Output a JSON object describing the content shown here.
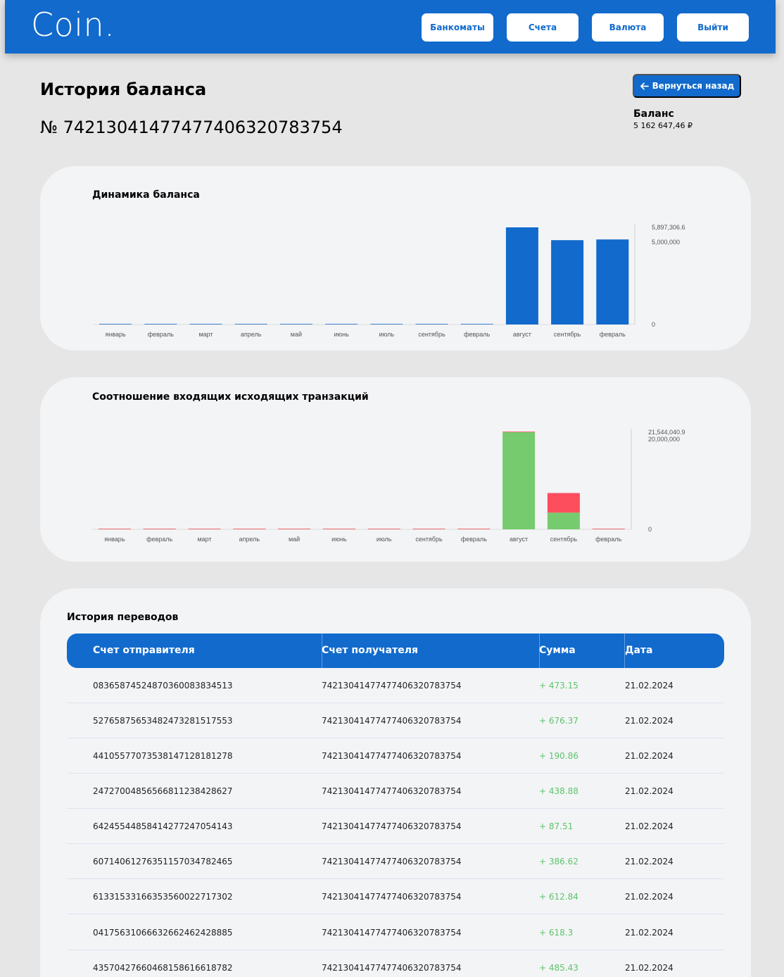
{
  "header": {
    "logo": "Coin.",
    "nav": [
      "Банкоматы",
      "Счета",
      "Валюта",
      "Выйти"
    ]
  },
  "page": {
    "title": "История баланса",
    "account_number": "№ 74213041477477406320783754",
    "back_label": "Вернуться назад",
    "balance_label": "Баланс",
    "balance_value": "5 162 647,46 ₽"
  },
  "colors": {
    "accent": "#116acc",
    "income": "#76cb6e",
    "outcome": "#fd4e5d",
    "card": "#f3f4f6"
  },
  "chart_data": [
    {
      "type": "bar",
      "title": "Динамика баланса",
      "categories": [
        "январь",
        "февраль",
        "март",
        "апрель",
        "май",
        "июнь",
        "июль",
        "сентябрь",
        "февраль",
        "август",
        "сентябрь",
        "февраль"
      ],
      "values": [
        0,
        0,
        0,
        0,
        0,
        0,
        0,
        0,
        20000,
        5897306.6,
        5120000,
        5162647.46
      ],
      "y_ticks": [
        "5,897,306.6",
        "5,000,000",
        "0"
      ],
      "y_tick_values": [
        5897306.6,
        5000000,
        0
      ],
      "ylim": [
        0,
        5897306.6
      ]
    },
    {
      "type": "bar",
      "stacked": true,
      "title": "Соотношение входящих исходящих транзакций",
      "categories": [
        "январь",
        "февраль",
        "март",
        "апрель",
        "май",
        "июнь",
        "июль",
        "сентябрь",
        "февраль",
        "август",
        "сентябрь",
        "февраль"
      ],
      "series": [
        {
          "values": [
            0,
            0,
            0,
            0,
            0,
            0,
            0,
            0,
            0,
            21544040.9,
            3700000,
            0
          ],
          "color": "#76cb6e"
        },
        {
          "values": [
            0,
            0,
            0,
            0,
            0,
            0,
            0,
            0,
            0,
            0,
            4350000,
            0
          ],
          "color": "#fd4e5d"
        }
      ],
      "y_ticks": [
        "21,544,040.9",
        "20,000,000",
        "0"
      ],
      "y_tick_values": [
        21544040.9,
        20000000,
        0
      ],
      "ylim": [
        0,
        21544040.9
      ]
    }
  ],
  "transfers": {
    "title": "История переводов",
    "columns": [
      "Счет отправителя",
      "Счет получателя",
      "Сумма",
      "Дата"
    ],
    "rows": [
      {
        "from": "08365874524870360083834513",
        "to": "74213041477477406320783754",
        "amount": "+ 473.15",
        "date": "21.02.2024"
      },
      {
        "from": "52765875653482473281517553",
        "to": "74213041477477406320783754",
        "amount": "+ 676.37",
        "date": "21.02.2024"
      },
      {
        "from": "44105577073538147128181278",
        "to": "74213041477477406320783754",
        "amount": "+ 190.86",
        "date": "21.02.2024"
      },
      {
        "from": "24727004856566811238428627",
        "to": "74213041477477406320783754",
        "amount": "+ 438.88",
        "date": "21.02.2024"
      },
      {
        "from": "64245544858414277247054143",
        "to": "74213041477477406320783754",
        "amount": "+ 87.51",
        "date": "21.02.2024"
      },
      {
        "from": "60714061276351157034782465",
        "to": "74213041477477406320783754",
        "amount": "+ 386.62",
        "date": "21.02.2024"
      },
      {
        "from": "61331533166353560022717302",
        "to": "74213041477477406320783754",
        "amount": "+ 612.84",
        "date": "21.02.2024"
      },
      {
        "from": "04175631066632662462428885",
        "to": "74213041477477406320783754",
        "amount": "+ 618.3",
        "date": "21.02.2024"
      },
      {
        "from": "43570427660468158616618782",
        "to": "74213041477477406320783754",
        "amount": "+ 485.43",
        "date": "21.02.2024"
      }
    ]
  }
}
